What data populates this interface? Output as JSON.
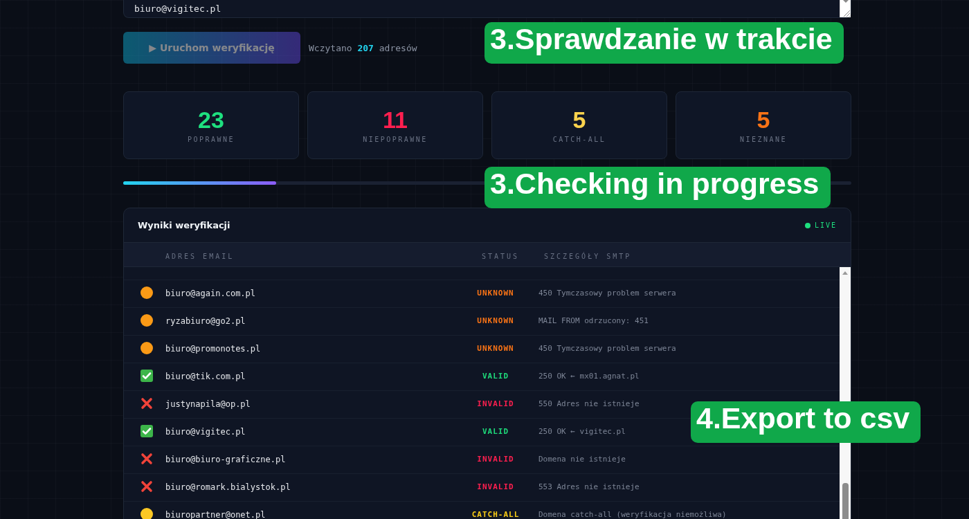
{
  "textarea": {
    "value": "biuro@vigitec.pl"
  },
  "start_button": {
    "label": "▶ Uruchom weryfikację",
    "disabled": true
  },
  "loaded_info": "Wczytano **207** adresów",
  "stats": [
    {
      "value": "23",
      "label": "POPRAWNE",
      "color": "#1ee07f"
    },
    {
      "value": "11",
      "label": "NIEPOPRAWNE",
      "color": "#ff1f4f"
    },
    {
      "value": "5",
      "label": "CATCH-ALL",
      "color": "#fcd34d"
    },
    {
      "value": "5",
      "label": "NIEZNANE",
      "color": "#f97316"
    }
  ],
  "progress": {
    "level": 0.21
  },
  "results": {
    "title": "Wyniki weryfikacji",
    "live": "LIVE",
    "columns": [
      "ADRES EMAIL",
      "STATUS",
      "SZCZEGÓŁY SMTP"
    ],
    "rows": [
      {
        "kind": "unknown",
        "email": "biuro@again.com.pl",
        "status": "UNKNOWN",
        "details": "450 Tymczasowy problem serwera"
      },
      {
        "kind": "unknown",
        "email": "ryzabiuro@go2.pl",
        "status": "UNKNOWN",
        "details": "MAIL FROM odrzucony: 451"
      },
      {
        "kind": "unknown",
        "email": "biuro@promonotes.pl",
        "status": "UNKNOWN",
        "details": "450 Tymczasowy problem serwera"
      },
      {
        "kind": "valid",
        "email": "biuro@tik.com.pl",
        "status": "VALID",
        "details": "250 OK ← mx01.agnat.pl"
      },
      {
        "kind": "invalid",
        "email": "justynapila@op.pl",
        "status": "INVALID",
        "details": "550 Adres nie istnieje"
      },
      {
        "kind": "valid",
        "email": "biuro@vigitec.pl",
        "status": "VALID",
        "details": "250 OK ← vigitec.pl"
      },
      {
        "kind": "invalid",
        "email": "biuro@biuro-graficzne.pl",
        "status": "INVALID",
        "details": "Domena nie istnieje"
      },
      {
        "kind": "invalid",
        "email": "biuro@romark.bialystok.pl",
        "status": "INVALID",
        "details": "553 Adres nie istnieje"
      },
      {
        "kind": "catch-all",
        "email": "biuropartner@onet.pl",
        "status": "CATCH-ALL",
        "details": "Domena catch-all (weryfikacja niemożliwa)"
      }
    ]
  },
  "annotations": [
    {
      "text": "3.Sprawdzanie w trakcie"
    },
    {
      "text": "3.Checking in progress"
    },
    {
      "text": "4.Export to csv"
    }
  ]
}
